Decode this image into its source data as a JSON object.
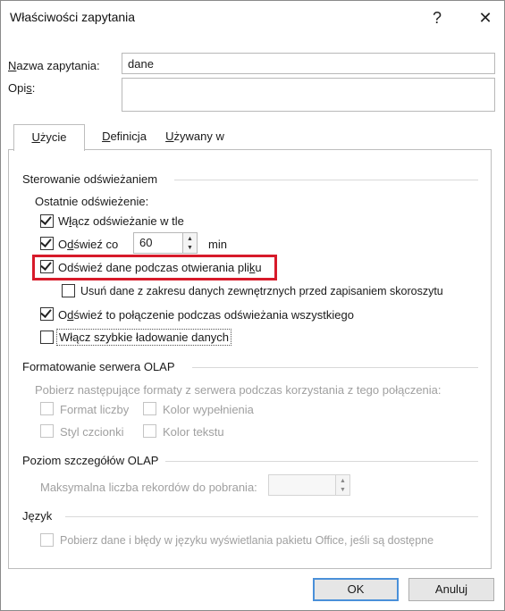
{
  "window": {
    "title": "Właściwości zapytania",
    "help": "?",
    "close": "✕"
  },
  "query_name": {
    "label_first": "N",
    "label_rest": "azwa zapytania:",
    "value": "dane"
  },
  "description": {
    "label_first": "Opi",
    "label_u": "s",
    "label_end": ":",
    "value": ""
  },
  "tabs": [
    {
      "u": "U",
      "rest": "życie"
    },
    {
      "u": "D",
      "rest": "efinicja"
    },
    {
      "u": "U",
      "rest": "żywany w"
    }
  ],
  "refresh": {
    "header": "Sterowanie odświeżaniem",
    "last_refresh": "Ostatnie odświeżenie:",
    "bg_refresh": {
      "pre": "W",
      "u": "ł",
      "post": "ącz odświeżanie w tle",
      "checked": true
    },
    "refresh_every": {
      "pre": "O",
      "u": "d",
      "post": "świeź co",
      "checked": true,
      "value": "60",
      "unit": "min"
    },
    "on_open": {
      "pre": "Odświeź dane podczas otwierania pli",
      "u": "k",
      "post": "u",
      "checked": true
    },
    "remove_data": {
      "text": "Usuń dane z zakresu danych zewnętrznych przed zapisaniem skoroszytu",
      "checked": false
    },
    "refresh_all": {
      "pre": "O",
      "u": "d",
      "post": "świeź to połączenie podczas odświeżania wszystkiego",
      "checked": true
    },
    "fast_load": {
      "text": "Włącz szybkie ładowanie danych",
      "checked": false
    }
  },
  "olap_format": {
    "header": "Formatowanie serwera OLAP",
    "desc": "Pobierz następujące formaty z serwera podczas korzystania z tego połączenia:",
    "number_format": "Format liczby",
    "fill_color": "Kolor wypełnienia",
    "font_style": "Styl czcionki",
    "text_color": "Kolor tekstu"
  },
  "olap_detail": {
    "header": "Poziom szczegółów OLAP",
    "max_records": "Maksymalna liczba rekordów do pobrania:",
    "value": ""
  },
  "language": {
    "header": "Język",
    "option": "Pobierz dane i błędy w języku wyświetlania pakietu Office, jeśli są dostępne"
  },
  "buttons": {
    "ok": "OK",
    "cancel": "Anuluj"
  },
  "colors": {
    "highlight": "#d71a2a",
    "default_button_border": "#4a90d9"
  }
}
